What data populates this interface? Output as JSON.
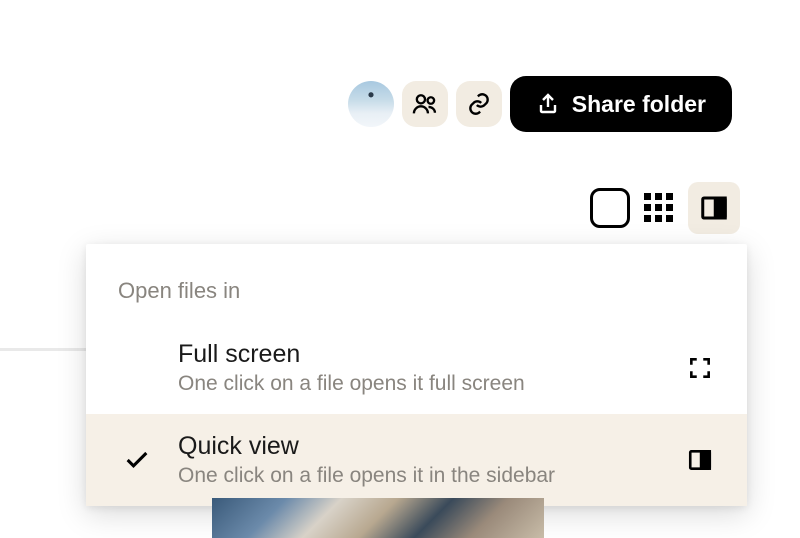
{
  "toolbar": {
    "share_label": "Share folder"
  },
  "dropdown": {
    "header": "Open files in",
    "options": [
      {
        "title": "Full screen",
        "desc": "One click on a file opens it full screen",
        "selected": false
      },
      {
        "title": "Quick view",
        "desc": "One click on a file opens it in the sidebar",
        "selected": true
      }
    ]
  }
}
